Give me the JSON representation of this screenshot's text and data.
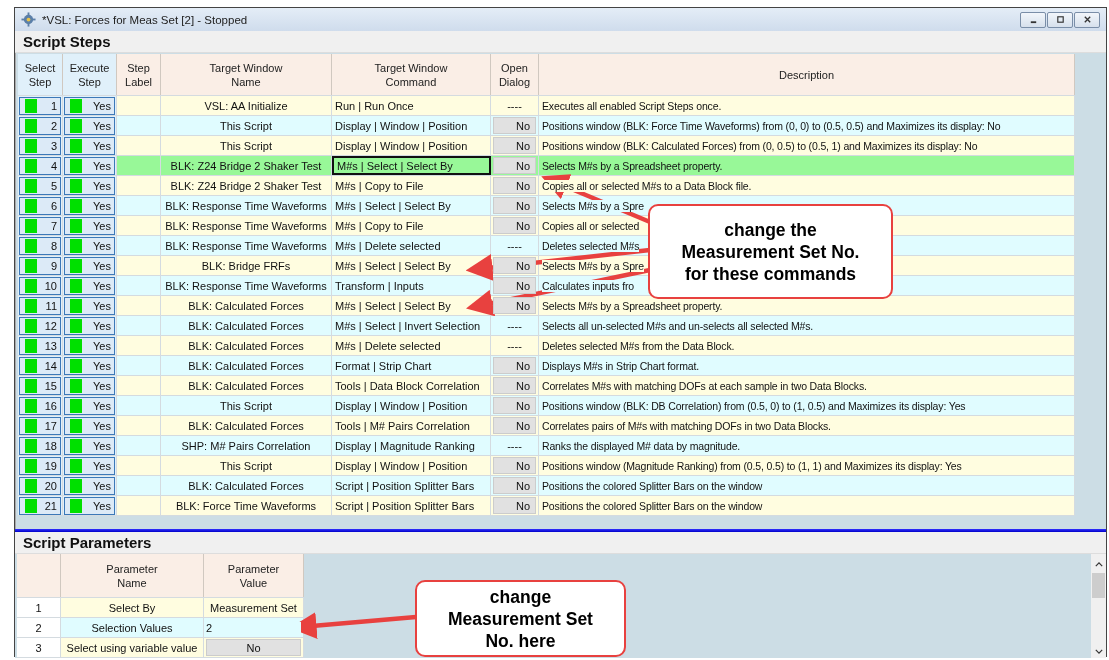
{
  "window": {
    "title": "*VSL: Forces for Meas Set [2] - Stopped"
  },
  "script_steps": {
    "title": "Script Steps",
    "columns": [
      "Select\nStep",
      "Execute\nStep",
      "Step\nLabel",
      "Target Window\nName",
      "Target Window\nCommand",
      "Open\nDialog",
      "Description"
    ],
    "rows": [
      {
        "step": "1",
        "execute": "Yes",
        "step_on": true,
        "execute_on": true,
        "target": "VSL: AA Initialize",
        "command": "Run | Run Once",
        "open_dialog": {
          "kind": "text",
          "label": "----"
        },
        "description": "Executes all enabled Script Steps once.",
        "selected": false,
        "focused": false
      },
      {
        "step": "2",
        "execute": "Yes",
        "step_on": true,
        "execute_on": true,
        "target": "This Script",
        "command": "Display | Window | Position",
        "open_dialog": {
          "kind": "toggle",
          "label": "No"
        },
        "description": "Positions window (BLK: Force Time Waveforms) from (0, 0) to (0.5, 0.5) and Maximizes its display: No",
        "selected": false,
        "focused": false
      },
      {
        "step": "3",
        "execute": "Yes",
        "step_on": true,
        "execute_on": true,
        "target": "This Script",
        "command": "Display | Window | Position",
        "open_dialog": {
          "kind": "toggle",
          "label": "No"
        },
        "description": "Positions window (BLK: Calculated Forces) from (0, 0.5) to (0.5, 1) and Maximizes its display: No",
        "selected": false,
        "focused": false
      },
      {
        "step": "4",
        "execute": "Yes",
        "step_on": true,
        "execute_on": true,
        "target": "BLK: Z24 Bridge 2 Shaker Test",
        "command": "M#s | Select | Select By",
        "open_dialog": {
          "kind": "toggle",
          "label": "No"
        },
        "description": "Selects M#s by a Spreadsheet property.",
        "selected": true,
        "focused": true
      },
      {
        "step": "5",
        "execute": "Yes",
        "step_on": true,
        "execute_on": true,
        "target": "BLK: Z24 Bridge 2 Shaker Test",
        "command": "M#s | Copy to File",
        "open_dialog": {
          "kind": "toggle",
          "label": "No"
        },
        "description": "Copies all or selected M#s to a Data Block file.",
        "selected": false,
        "focused": false
      },
      {
        "step": "6",
        "execute": "Yes",
        "step_on": true,
        "execute_on": true,
        "target": "BLK: Response Time Waveforms",
        "command": "M#s | Select | Select By",
        "open_dialog": {
          "kind": "toggle",
          "label": "No"
        },
        "description": "Selects M#s by a Spre",
        "selected": false,
        "focused": false
      },
      {
        "step": "7",
        "execute": "Yes",
        "step_on": true,
        "execute_on": true,
        "target": "BLK: Response Time Waveforms",
        "command": "M#s | Copy to File",
        "open_dialog": {
          "kind": "toggle",
          "label": "No"
        },
        "description": "Copies all or selected",
        "selected": false,
        "focused": false
      },
      {
        "step": "8",
        "execute": "Yes",
        "step_on": true,
        "execute_on": true,
        "target": "BLK: Response Time Waveforms",
        "command": "M#s | Delete selected",
        "open_dialog": {
          "kind": "text",
          "label": "----"
        },
        "description": "Deletes selected M#s",
        "selected": false,
        "focused": false
      },
      {
        "step": "9",
        "execute": "Yes",
        "step_on": true,
        "execute_on": true,
        "target": "BLK: Bridge FRFs",
        "command": "M#s | Select | Select By",
        "open_dialog": {
          "kind": "toggle",
          "label": "No"
        },
        "description": "Selects M#s by a Spre",
        "selected": false,
        "focused": false
      },
      {
        "step": "10",
        "execute": "Yes",
        "step_on": true,
        "execute_on": true,
        "target": "BLK: Response Time Waveforms",
        "command": "Transform | Inputs",
        "open_dialog": {
          "kind": "toggle",
          "label": "No"
        },
        "description": "Calculates inputs fro",
        "selected": false,
        "focused": false
      },
      {
        "step": "11",
        "execute": "Yes",
        "step_on": true,
        "execute_on": true,
        "target": "BLK: Calculated Forces",
        "command": "M#s | Select | Select By",
        "open_dialog": {
          "kind": "toggle",
          "label": "No"
        },
        "description": "Selects M#s by a Spreadsheet property.",
        "selected": false,
        "focused": false
      },
      {
        "step": "12",
        "execute": "Yes",
        "step_on": true,
        "execute_on": true,
        "target": "BLK: Calculated Forces",
        "command": "M#s | Select | Invert Selection",
        "open_dialog": {
          "kind": "text",
          "label": "----"
        },
        "description": "Selects all un-selected M#s and un-selects all selected M#s.",
        "selected": false,
        "focused": false
      },
      {
        "step": "13",
        "execute": "Yes",
        "step_on": true,
        "execute_on": true,
        "target": "BLK: Calculated Forces",
        "command": "M#s | Delete selected",
        "open_dialog": {
          "kind": "text",
          "label": "----"
        },
        "description": "Deletes selected M#s from the Data Block.",
        "selected": false,
        "focused": false
      },
      {
        "step": "14",
        "execute": "Yes",
        "step_on": true,
        "execute_on": true,
        "target": "BLK: Calculated Forces",
        "command": "Format | Strip Chart",
        "open_dialog": {
          "kind": "toggle",
          "label": "No"
        },
        "description": "Displays M#s in Strip Chart format.",
        "selected": false,
        "focused": false
      },
      {
        "step": "15",
        "execute": "Yes",
        "step_on": true,
        "execute_on": true,
        "target": "BLK: Calculated Forces",
        "command": "Tools | Data Block Correlation",
        "open_dialog": {
          "kind": "toggle",
          "label": "No"
        },
        "description": "Correlates M#s with matching DOFs at each sample in two Data Blocks.",
        "selected": false,
        "focused": false
      },
      {
        "step": "16",
        "execute": "Yes",
        "step_on": true,
        "execute_on": true,
        "target": "This Script",
        "command": "Display | Window | Position",
        "open_dialog": {
          "kind": "toggle",
          "label": "No"
        },
        "description": "Positions window (BLK: DB Correlation) from (0.5, 0) to (1, 0.5) and Maximizes its display: Yes",
        "selected": false,
        "focused": false
      },
      {
        "step": "17",
        "execute": "Yes",
        "step_on": true,
        "execute_on": true,
        "target": "BLK: Calculated Forces",
        "command": "Tools | M# Pairs Correlation",
        "open_dialog": {
          "kind": "toggle",
          "label": "No"
        },
        "description": "Correlates pairs of M#s with matching DOFs in two Data Blocks.",
        "selected": false,
        "focused": false
      },
      {
        "step": "18",
        "execute": "Yes",
        "step_on": true,
        "execute_on": true,
        "target": "SHP: M# Pairs Correlation",
        "command": "Display | Magnitude Ranking",
        "open_dialog": {
          "kind": "text",
          "label": "----"
        },
        "description": "Ranks the displayed M# data by magnitude.",
        "selected": false,
        "focused": false
      },
      {
        "step": "19",
        "execute": "Yes",
        "step_on": true,
        "execute_on": true,
        "target": "This Script",
        "command": "Display | Window | Position",
        "open_dialog": {
          "kind": "toggle",
          "label": "No"
        },
        "description": "Positions window (Magnitude Ranking) from (0.5, 0.5) to (1, 1) and Maximizes its display: Yes",
        "selected": false,
        "focused": false
      },
      {
        "step": "20",
        "execute": "Yes",
        "step_on": true,
        "execute_on": true,
        "target": "BLK: Calculated Forces",
        "command": "Script | Position Splitter Bars",
        "open_dialog": {
          "kind": "toggle",
          "label": "No"
        },
        "description": "Positions the colored Splitter Bars on the window",
        "selected": false,
        "focused": false
      },
      {
        "step": "21",
        "execute": "Yes",
        "step_on": true,
        "execute_on": true,
        "target": "BLK: Force Time Waveforms",
        "command": "Script | Position Splitter Bars",
        "open_dialog": {
          "kind": "toggle",
          "label": "No"
        },
        "description": "Positions the colored Splitter Bars on the window",
        "selected": false,
        "focused": false
      }
    ]
  },
  "script_parameters": {
    "title": "Script Parameters",
    "columns": [
      "Parameter\nName",
      "Parameter\nValue"
    ],
    "rows": [
      {
        "index": "1",
        "name": "Select By",
        "value": {
          "kind": "text",
          "label": "Measurement Set"
        }
      },
      {
        "index": "2",
        "name": "Selection Values",
        "value": {
          "kind": "input",
          "label": "2"
        }
      },
      {
        "index": "3",
        "name": "Select using variable value",
        "value": {
          "kind": "toggle",
          "label": "No"
        }
      }
    ]
  },
  "callouts": [
    {
      "text": "change the\nMeasurement Set No.\nfor these commands"
    },
    {
      "text": "change\nMeasurement Set\nNo. here"
    }
  ]
}
